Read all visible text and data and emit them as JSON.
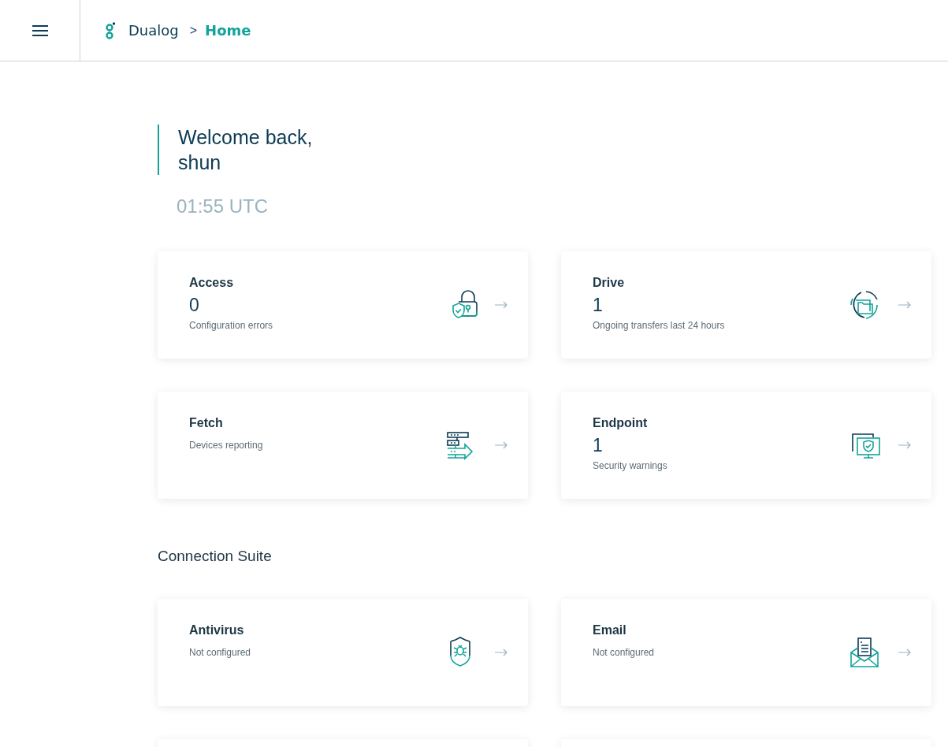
{
  "header": {
    "brand": "Dualog",
    "separator": ">",
    "page": "Home"
  },
  "welcome": {
    "greeting": "Welcome back,",
    "user": "shun",
    "time": "01:55 UTC"
  },
  "cards": [
    {
      "kind": "lock",
      "title": "Access",
      "count": "0",
      "caption": "Configuration errors"
    },
    {
      "kind": "sync",
      "title": "Drive",
      "count": "1",
      "caption": "Ongoing transfers last 24 hours"
    },
    {
      "kind": "servers",
      "title": "Fetch",
      "caption": "Devices reporting"
    },
    {
      "kind": "monitors",
      "title": "Endpoint",
      "count": "1",
      "caption": "Security warnings"
    }
  ],
  "section": {
    "title": "Connection Suite",
    "cards": [
      {
        "kind": "bug",
        "title": "Antivirus",
        "caption": "Not configured"
      },
      {
        "kind": "mail",
        "title": "Email",
        "caption": "Not configured"
      },
      {
        "kind": "blank"
      },
      {
        "kind": "blank"
      }
    ]
  }
}
